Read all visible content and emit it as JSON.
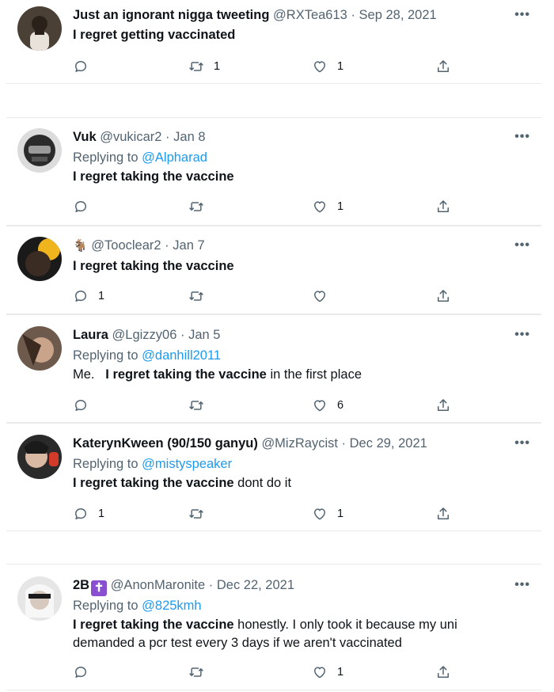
{
  "tweets": [
    {
      "display_name": "Just an ignorant nigga tweeting",
      "handle": "@RXTea613",
      "sep": "·",
      "date": "Sep 28, 2021",
      "replying_label": "",
      "replying_to": "",
      "text_bold": "I regret getting vaccinated",
      "text_rest": "",
      "reply_count": "",
      "retweet_count": "1",
      "like_count": "1"
    },
    {
      "display_name": "Vuk",
      "handle": "@vukicar2",
      "sep": "·",
      "date": "Jan 8",
      "replying_label": "Replying to",
      "replying_to": "@Alpharad",
      "text_bold": "I regret taking the vaccine",
      "text_rest": "",
      "reply_count": "",
      "retweet_count": "",
      "like_count": "1"
    },
    {
      "display_name": "🐐",
      "handle": "@Tooclear2",
      "sep": "·",
      "date": "Jan 7",
      "replying_label": "",
      "replying_to": "",
      "text_bold": "I regret taking the vaccine",
      "text_rest": "",
      "reply_count": "1",
      "retweet_count": "",
      "like_count": ""
    },
    {
      "display_name": "Laura",
      "handle": "@Lgizzy06",
      "sep": "·",
      "date": "Jan 5",
      "replying_label": "Replying to",
      "replying_to": "@danhill2011",
      "text_pre": "Me.",
      "text_bold": "I regret taking the vaccine",
      "text_rest": " in the first place",
      "reply_count": "",
      "retweet_count": "",
      "like_count": "6"
    },
    {
      "display_name": "KaterynKween (90/150 ganyu)",
      "handle": "@MizRaycist",
      "sep": "·",
      "date": "Dec 29, 2021",
      "replying_label": "Replying to",
      "replying_to": "@mistyspeaker",
      "text_bold": "I regret taking the vaccine",
      "text_rest": " dont do it",
      "reply_count": "1",
      "retweet_count": "",
      "like_count": "1"
    },
    {
      "display_name": "2B",
      "badge": "✝",
      "handle": "@AnonMaronite",
      "sep": "·",
      "date": "Dec 22, 2021",
      "replying_label": "Replying to",
      "replying_to": "@825kmh",
      "text_bold": "I regret taking the vaccine",
      "text_rest": " honestly. I only took it because my uni",
      "text_line2": "demanded a pcr test every 3 days if we aren't vaccinated",
      "reply_count": "",
      "retweet_count": "",
      "like_count": "1"
    }
  ],
  "more_label": "•••",
  "icons": {
    "reply": "reply-icon",
    "retweet": "retweet-icon",
    "like": "like-icon",
    "share": "share-icon",
    "more": "more-icon"
  },
  "colors": {
    "text": "#0f1419",
    "muted": "#536471",
    "link": "#1d9bf0",
    "divider": "#e8eaec",
    "badge": "#8a4fd1"
  }
}
